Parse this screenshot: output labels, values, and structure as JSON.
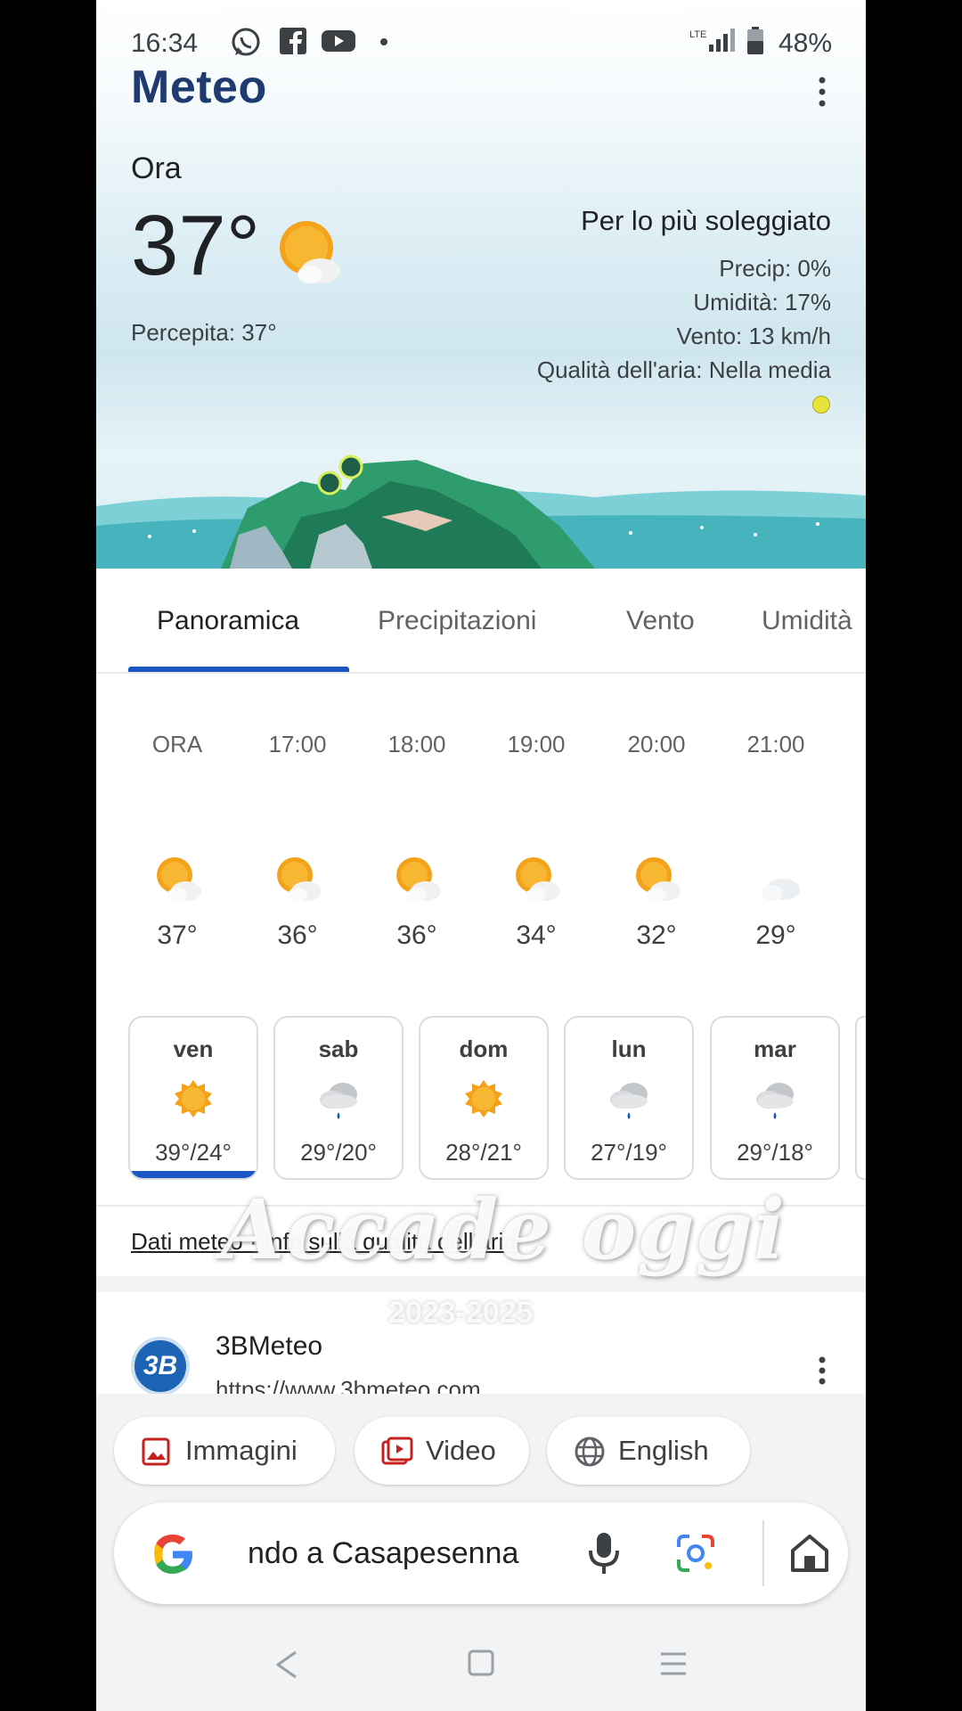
{
  "status_bar": {
    "time": "16:34",
    "battery": "48%",
    "icons": [
      "whatsapp-icon",
      "facebook-icon",
      "youtube-icon",
      "dot-icon",
      "lte-signal-icon",
      "battery-icon"
    ]
  },
  "header": {
    "title": "Meteo",
    "menu_icon": "more-vert-icon"
  },
  "current": {
    "label": "Ora",
    "temperature": "37°",
    "feels_like": "Percepita: 37°",
    "condition": "Per lo più soleggiato",
    "precip": "Precip: 0%",
    "humidity": "Umidità: 17%",
    "wind": "Vento: 13 km/h",
    "air_quality": "Qualità dell'aria: Nella media",
    "air_quality_color": "#e8e33a",
    "icon": "partly-sunny-icon"
  },
  "tabs": [
    {
      "label": "Panoramica",
      "active": true
    },
    {
      "label": "Precipitazioni",
      "active": false
    },
    {
      "label": "Vento",
      "active": false
    },
    {
      "label": "Umidità",
      "active": false
    }
  ],
  "hourly": [
    {
      "time": "ORA",
      "temp": "37°",
      "icon": "partly-sunny-icon"
    },
    {
      "time": "17:00",
      "temp": "36°",
      "icon": "partly-sunny-icon"
    },
    {
      "time": "18:00",
      "temp": "36°",
      "icon": "partly-sunny-icon"
    },
    {
      "time": "19:00",
      "temp": "34°",
      "icon": "partly-sunny-icon"
    },
    {
      "time": "20:00",
      "temp": "32°",
      "icon": "partly-sunny-icon"
    },
    {
      "time": "21:00",
      "temp": "29°",
      "icon": "partly-cloudy-night-icon"
    }
  ],
  "daily": [
    {
      "day": "ven",
      "temps": "39°/24°",
      "icon": "sunny-icon",
      "selected": true
    },
    {
      "day": "sab",
      "temps": "29°/20°",
      "icon": "rain-cloud-icon",
      "selected": false
    },
    {
      "day": "dom",
      "temps": "28°/21°",
      "icon": "sunny-icon",
      "selected": false
    },
    {
      "day": "lun",
      "temps": "27°/19°",
      "icon": "rain-cloud-icon",
      "selected": false
    },
    {
      "day": "mar",
      "temps": "29°/18°",
      "icon": "rain-cloud-icon",
      "selected": false
    }
  ],
  "data_link": "Dati meteo · Info sulla qualità dell'aria",
  "watermark": {
    "title": "Accade oggi",
    "years": "2023-2025"
  },
  "result": {
    "site": "3BMeteo",
    "url": "https://www.3bmeteo.com",
    "logo_text": "3B"
  },
  "chips": [
    {
      "label": "Immagini",
      "icon": "image-icon",
      "color": "#c5221f"
    },
    {
      "label": "Video",
      "icon": "video-icon",
      "color": "#c5221f"
    },
    {
      "label": "English",
      "icon": "globe-icon",
      "color": "#5f6368"
    }
  ],
  "search": {
    "query": "ndo a Casapesenna"
  },
  "colors": {
    "accent": "#1a56c4",
    "title": "#1f3a6e",
    "sun": "#f4a21a"
  }
}
